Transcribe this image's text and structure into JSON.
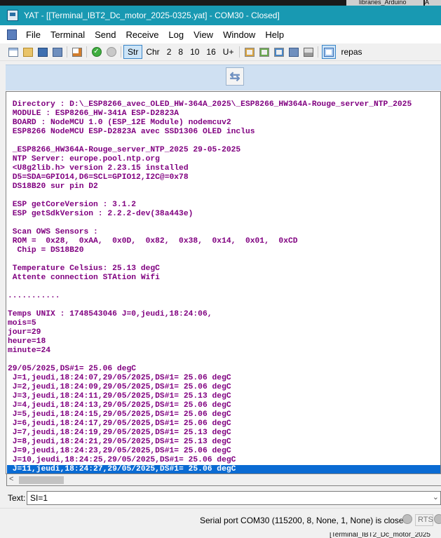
{
  "topstrip": {
    "tab1": "libraries_Arduino",
    "tab2": "A"
  },
  "window": {
    "title": "YAT - [[Terminal_IBT2_Dc_motor_2025-0325.yat] - COM30 - Closed]"
  },
  "menu": [
    "File",
    "Terminal",
    "Send",
    "Receive",
    "Log",
    "View",
    "Window",
    "Help"
  ],
  "toolbar": {
    "str": "Str",
    "chr": "Chr",
    "n2": "2",
    "n8": "8",
    "n10": "10",
    "n16": "16",
    "u": "U+",
    "repas": "repas"
  },
  "panel": {
    "swap_glyph": "⇆"
  },
  "terminal": {
    "lines": [
      " Directory : D:\\_ESP8266_avec_OLED_HW-364A_2025\\_ESP8266_HW364A-Rouge_server_NTP_2025",
      " MODULE : ESP8266_HW-341A ESP-D2823A",
      " BOARD : NodeMCU 1.0 (ESP_12E Module) nodemcuv2",
      " ESP8266 NodeMCU ESP-D2823A avec SSD1306 OLED inclus",
      "",
      " _ESP8266_HW364A-Rouge_server_NTP_2025 29-05-2025",
      " NTP Server: europe.pool.ntp.org",
      " <U8g2lib.h> version 2.23.15 installed",
      " D5=SDA=GPIO14,D6=SCL=GPIO12,I2C@=0x78",
      " DS18B20 sur pin D2",
      "",
      " ESP getCoreVersion : 3.1.2",
      " ESP getSdkVersion : 2.2.2-dev(38a443e)",
      "",
      " Scan OWS Sensors :",
      " ROM =  0x28,  0xAA,  0x0D,  0x82,  0x38,  0x14,  0x01,  0xCD",
      "  Chip = DS18B20",
      "",
      " Temperature Celsius: 25.13 degC",
      " Attente connection STAtion Wifi",
      "",
      "...........",
      "",
      "Temps UNIX : 1748543046 J=0,jeudi,18:24:06,",
      "mois=5",
      "jour=29",
      "heure=18",
      "minute=24",
      "",
      "29/05/2025,DS#1= 25.06 degC",
      " J=1,jeudi,18:24:07,29/05/2025,DS#1= 25.06 degC",
      " J=2,jeudi,18:24:09,29/05/2025,DS#1= 25.06 degC",
      " J=3,jeudi,18:24:11,29/05/2025,DS#1= 25.13 degC",
      " J=4,jeudi,18:24:13,29/05/2025,DS#1= 25.06 degC",
      " J=5,jeudi,18:24:15,29/05/2025,DS#1= 25.06 degC",
      " J=6,jeudi,18:24:17,29/05/2025,DS#1= 25.06 degC",
      " J=7,jeudi,18:24:19,29/05/2025,DS#1= 25.13 degC",
      " J=8,jeudi,18:24:21,29/05/2025,DS#1= 25.13 degC",
      " J=9,jeudi,18:24:23,29/05/2025,DS#1= 25.06 degC",
      " J=10,jeudi,18:24:25,29/05/2025,DS#1= 25.06 degC",
      " J=11,jeudi,18:24:27,29/05/2025,DS#1= 25.06 degC"
    ],
    "selected_index": 40,
    "text_color": "#800080",
    "selection_color": "#0a6bd3"
  },
  "send": {
    "label": "Text:",
    "value": "SI=1"
  },
  "status": {
    "text": "Serial port COM30 (115200, 8, None, 1, None) is closed",
    "rts": "RTS"
  },
  "bottom": {
    "title": "[Terminal_IBT2_Dc_motor_2025"
  }
}
